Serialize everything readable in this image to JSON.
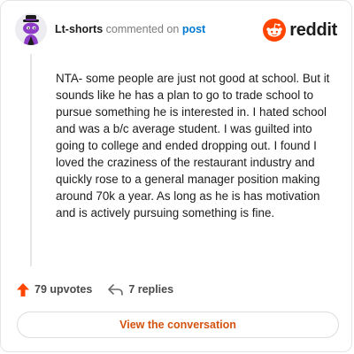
{
  "header": {
    "username": "Lt-shorts",
    "action_text": "commented on",
    "post_link": "post",
    "brand": "reddit"
  },
  "comment": {
    "body": "NTA- some people are just not good at school. But it sounds like he has a plan to go to trade school to pursue something he is interested in. I hated school and was a b/c average student. I was guilted into going to college and ended dropping out. I found I loved the craziness of the restaurant industry and quickly rose to a general manager position making around 70k a year. As long as he is has motivation and is actively pursuing something is fine."
  },
  "actions": {
    "upvotes_label": "79 upvotes",
    "replies_label": "7 replies"
  },
  "cta": {
    "view_conversation": "View the conversation"
  },
  "colors": {
    "brand_orange": "#ff4500",
    "link_blue": "#0079d3",
    "cta_orange": "#d4520f",
    "border": "#e3e5e8"
  },
  "icons": [
    "snoo-avatar-icon",
    "reddit-logo-icon",
    "upvote-arrow-icon",
    "reply-arrow-icon"
  ]
}
